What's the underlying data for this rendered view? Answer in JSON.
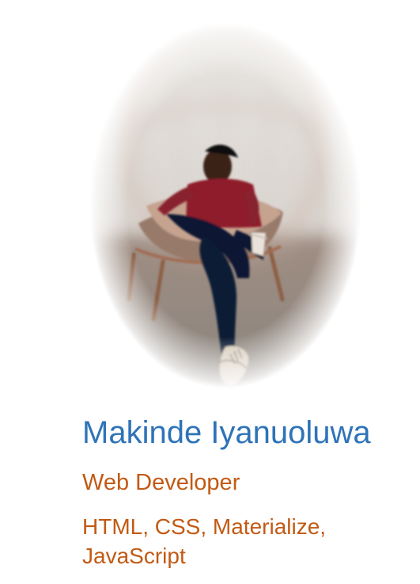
{
  "profile": {
    "photo_alt": "portrait-photo",
    "name": "Makinde Iyanuoluwa",
    "role": "Web Developer",
    "skills": "HTML, CSS, Materialize, JavaScript"
  },
  "colors": {
    "name_blue": "#2f73b8",
    "accent_orange": "#c25a14",
    "background": "#ffffff"
  }
}
